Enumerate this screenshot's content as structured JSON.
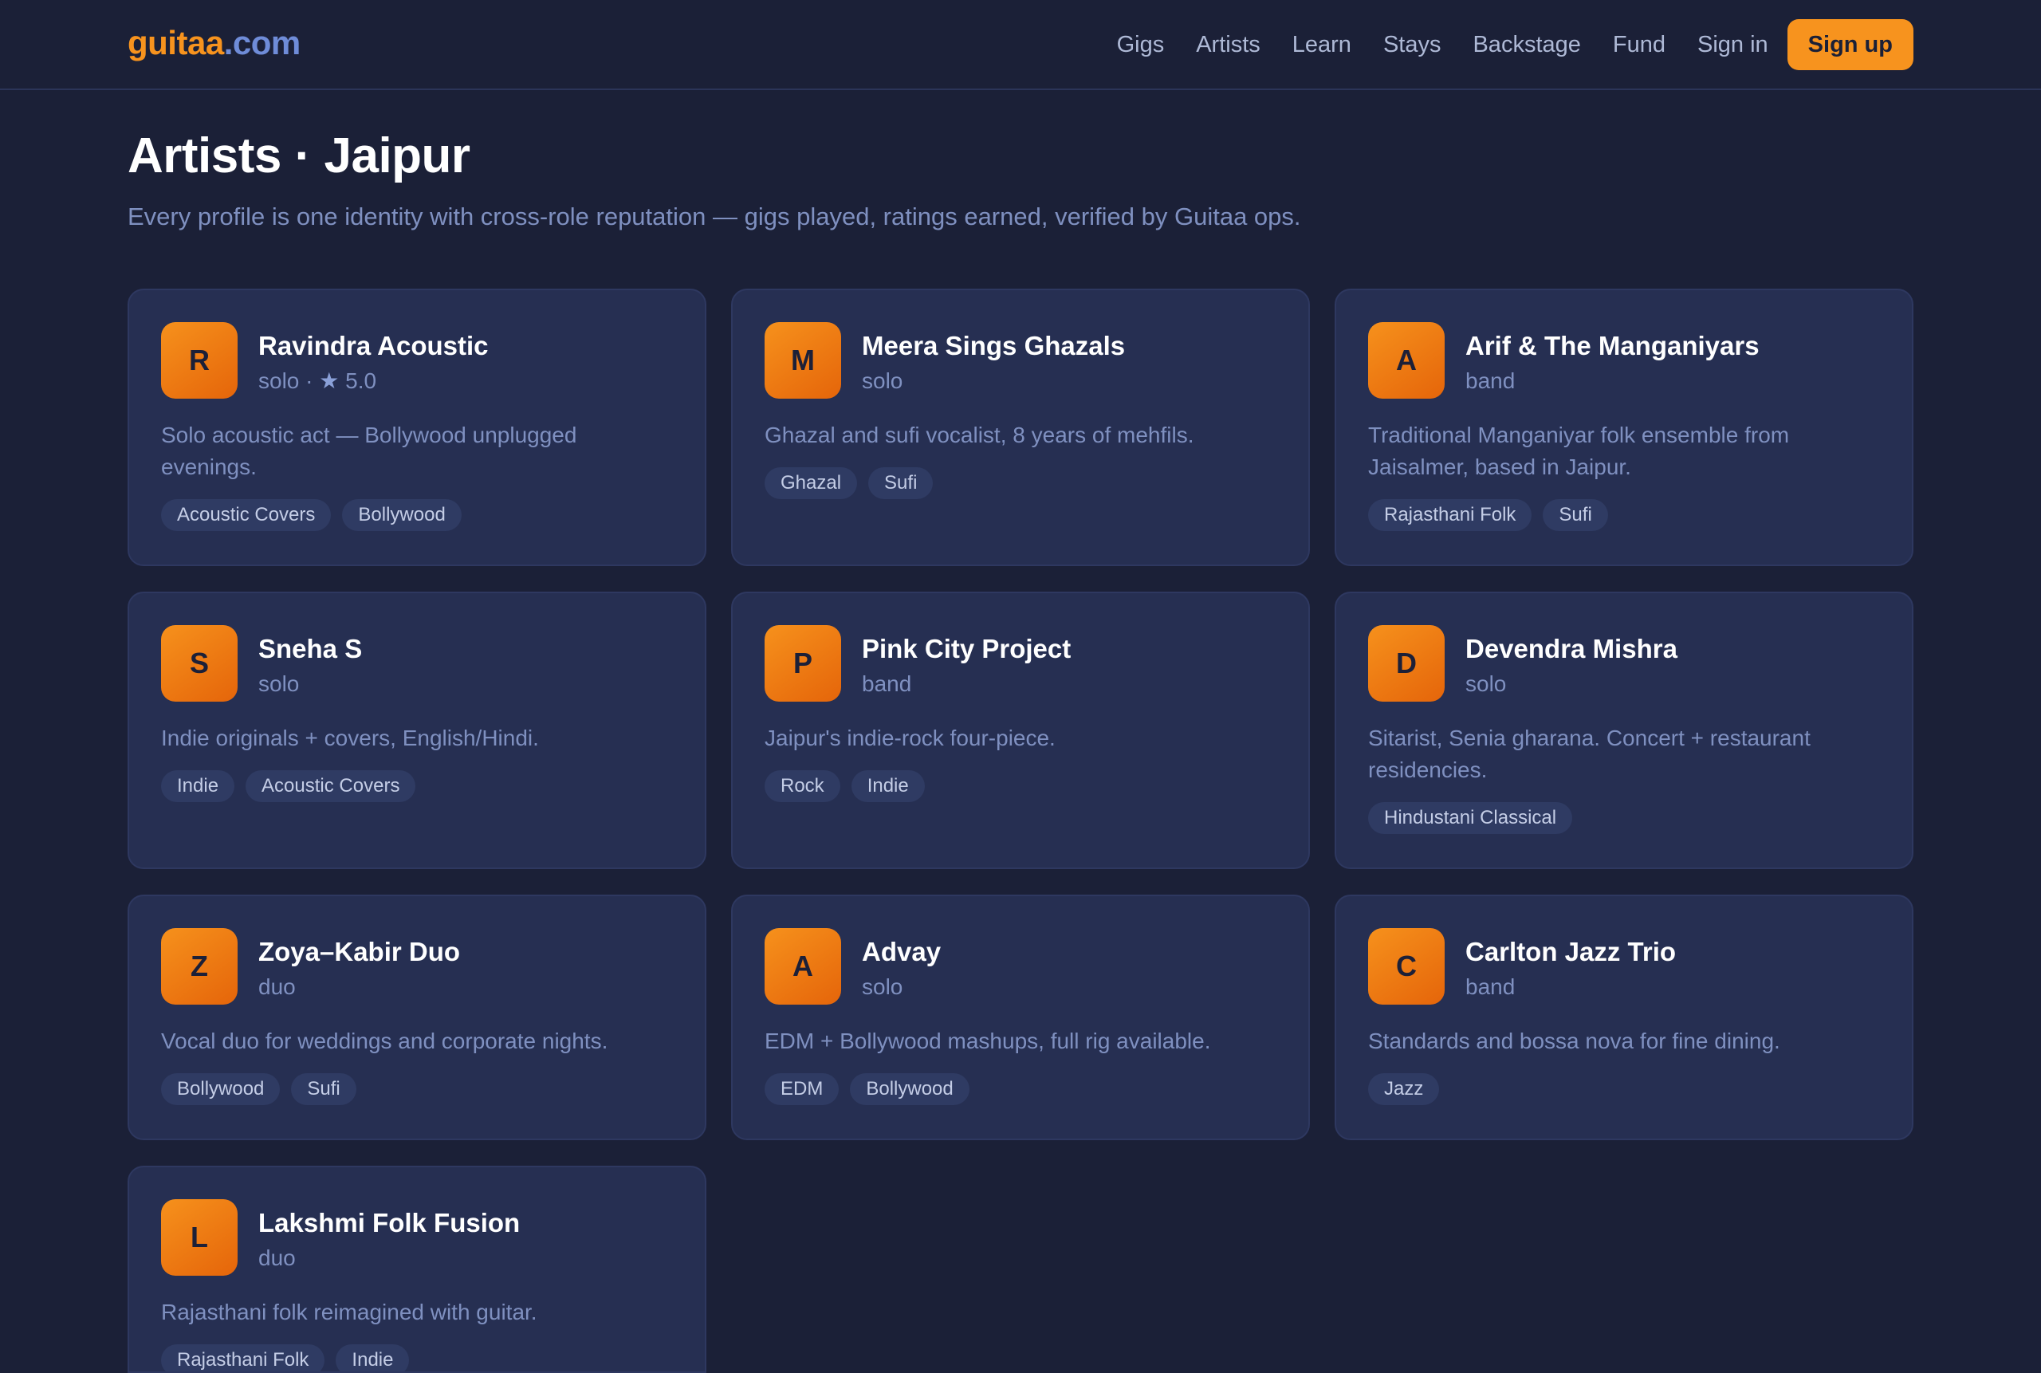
{
  "header": {
    "logo_main": "guitaa",
    "logo_tld": ".com",
    "nav": [
      "Gigs",
      "Artists",
      "Learn",
      "Stays",
      "Backstage",
      "Fund",
      "Sign in"
    ],
    "signup_label": "Sign up"
  },
  "page": {
    "title": "Artists · Jaipur",
    "subtitle": "Every profile is one identity with cross-role reputation — gigs played, ratings earned, verified by Guitaa ops."
  },
  "artists": [
    {
      "initial": "R",
      "name": "Ravindra Acoustic",
      "type": "solo",
      "rating": "5.0",
      "description": "Solo acoustic act — Bollywood unplugged evenings.",
      "tags": [
        "Acoustic Covers",
        "Bollywood"
      ]
    },
    {
      "initial": "M",
      "name": "Meera Sings Ghazals",
      "type": "solo",
      "description": "Ghazal and sufi vocalist, 8 years of mehfils.",
      "tags": [
        "Ghazal",
        "Sufi"
      ]
    },
    {
      "initial": "A",
      "name": "Arif & The Manganiyars",
      "type": "band",
      "description": "Traditional Manganiyar folk ensemble from Jaisalmer, based in Jaipur.",
      "tags": [
        "Rajasthani Folk",
        "Sufi"
      ]
    },
    {
      "initial": "S",
      "name": "Sneha S",
      "type": "solo",
      "description": "Indie originals + covers, English/Hindi.",
      "tags": [
        "Indie",
        "Acoustic Covers"
      ]
    },
    {
      "initial": "P",
      "name": "Pink City Project",
      "type": "band",
      "description": "Jaipur's indie-rock four-piece.",
      "tags": [
        "Rock",
        "Indie"
      ]
    },
    {
      "initial": "D",
      "name": "Devendra Mishra",
      "type": "solo",
      "description": "Sitarist, Senia gharana. Concert + restaurant residencies.",
      "tags": [
        "Hindustani Classical"
      ]
    },
    {
      "initial": "Z",
      "name": "Zoya–Kabir Duo",
      "type": "duo",
      "description": "Vocal duo for weddings and corporate nights.",
      "tags": [
        "Bollywood",
        "Sufi"
      ]
    },
    {
      "initial": "A",
      "name": "Advay",
      "type": "solo",
      "description": "EDM + Bollywood mashups, full rig available.",
      "tags": [
        "EDM",
        "Bollywood"
      ]
    },
    {
      "initial": "C",
      "name": "Carlton Jazz Trio",
      "type": "band",
      "description": "Standards and bossa nova for fine dining.",
      "tags": [
        "Jazz"
      ]
    },
    {
      "initial": "L",
      "name": "Lakshmi Folk Fusion",
      "type": "duo",
      "description": "Rajasthani folk reimagined with guitar.",
      "tags": [
        "Rajasthani Folk",
        "Indie"
      ]
    }
  ]
}
